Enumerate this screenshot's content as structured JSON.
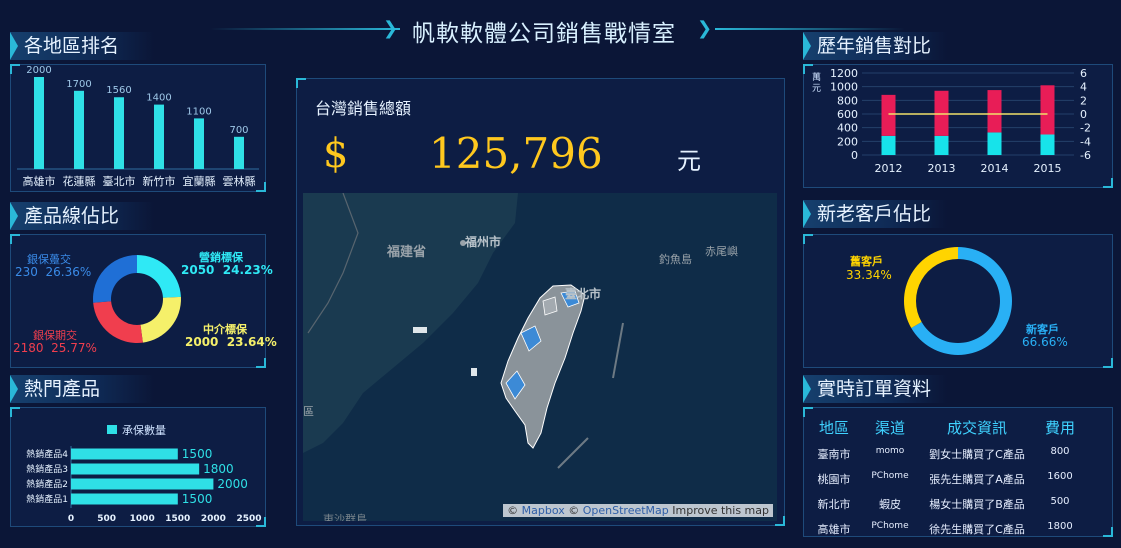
{
  "page": {
    "title": "帆軟軟體公司銷售戰情室"
  },
  "region_rank": {
    "title": "各地區排名",
    "chart_data": {
      "type": "bar",
      "categories": [
        "高雄市",
        "花蓮縣",
        "臺北市",
        "新竹市",
        "宜蘭縣",
        "雲林縣"
      ],
      "values": [
        2000,
        1700,
        1560,
        1400,
        1100,
        700
      ]
    }
  },
  "product_share": {
    "title": "產品線佔比",
    "chart_data": {
      "type": "pie",
      "slices": [
        {
          "name": "營銷標保",
          "value": 2050,
          "pct": "24.23%",
          "color": "#2fe9f5"
        },
        {
          "name": "中介標保",
          "value": 2000,
          "pct": "23.64%",
          "color": "#f5f06a"
        },
        {
          "name": "銀保期交",
          "value": 2180,
          "pct": "25.77%",
          "color": "#f03e4e"
        },
        {
          "name": "銀保躉交",
          "value": 230,
          "pct": "26.36%",
          "color": "#1f6fd6"
        }
      ]
    },
    "labels": {
      "s1_name": "營銷標保",
      "s1_val": "2050  24.23%",
      "s2_name": "中介標保",
      "s2_val": "2000  23.64%",
      "s3_name": "銀保期交",
      "s3_val": "2180  25.77%",
      "s4_name": "銀保躉交",
      "s4_val": "230  26.36%"
    }
  },
  "hot_products": {
    "title": "熱門產品",
    "legend": "承保數量",
    "chart_data": {
      "type": "bar",
      "orientation": "horizontal",
      "categories": [
        "熱銷產品4",
        "熱銷產品3",
        "熱銷產品2",
        "熱銷產品1"
      ],
      "values": [
        1500,
        1800,
        2000,
        1500
      ],
      "xlim": [
        0,
        2500
      ],
      "xticks": [
        "0",
        "500",
        "1000",
        "1500",
        "2000",
        "2500"
      ]
    }
  },
  "total_sales": {
    "title": "台灣銷售總額",
    "currency": "$",
    "amount": "125,796",
    "unit": "元"
  },
  "map": {
    "labels": {
      "fujian": "福建省",
      "fuzhou": "福州市",
      "taipei": "臺北市",
      "diaoyu": "釣魚島",
      "chiwei": "赤尾嶼",
      "bottom": "東沙群島",
      "left": "區"
    },
    "attribution": {
      "copy1": "©",
      "mapbox": "Mapbox",
      "copy2": "©",
      "osm": "OpenStreetMap",
      "improve": "Improve this map"
    }
  },
  "yearly": {
    "title": "歷年銷售對比",
    "ylabel": "萬元",
    "chart_data": {
      "type": "bar",
      "stacked": true,
      "categories": [
        "2012",
        "2013",
        "2014",
        "2015"
      ],
      "series": [
        {
          "values": [
            280,
            280,
            330,
            300
          ],
          "color": "#17e3ea"
        },
        {
          "values": [
            600,
            660,
            620,
            720
          ],
          "color": "#e81d57"
        }
      ],
      "line": {
        "values": [
          0,
          0,
          0,
          0
        ],
        "color": "#f0e06a"
      },
      "yticks": [
        "1200",
        "1000",
        "800",
        "600",
        "400",
        "200",
        "0"
      ],
      "y2ticks": [
        "6",
        "4",
        "2",
        "0",
        "-2",
        "-4",
        "-6"
      ],
      "ylim": [
        0,
        1200
      ],
      "y2lim": [
        -6,
        6
      ]
    }
  },
  "customers": {
    "title": "新老客戶佔比",
    "chart_data": {
      "type": "pie",
      "slices": [
        {
          "name": "新客戶",
          "pct": "66.66%",
          "color": "#29b0f5"
        },
        {
          "name": "舊客戶",
          "pct": "33.34%",
          "color": "#ffd400"
        }
      ]
    },
    "old_label": "舊客戶",
    "old_pct": "33.34%",
    "new_label": "新客戶",
    "new_pct": "66.66%"
  },
  "orders": {
    "title": "實時訂單資料",
    "headers": [
      "地區",
      "渠道",
      "成交資訊",
      "費用"
    ],
    "rows": [
      [
        "臺南市",
        "momo",
        "劉女士購買了C產品",
        "800"
      ],
      [
        "桃園市",
        "PChome",
        "張先生購買了A產品",
        "1600"
      ],
      [
        "新北市",
        "蝦皮",
        "楊女士購買了B產品",
        "500"
      ],
      [
        "高雄市",
        "PChome",
        "徐先生購買了C產品",
        "1800"
      ]
    ]
  }
}
